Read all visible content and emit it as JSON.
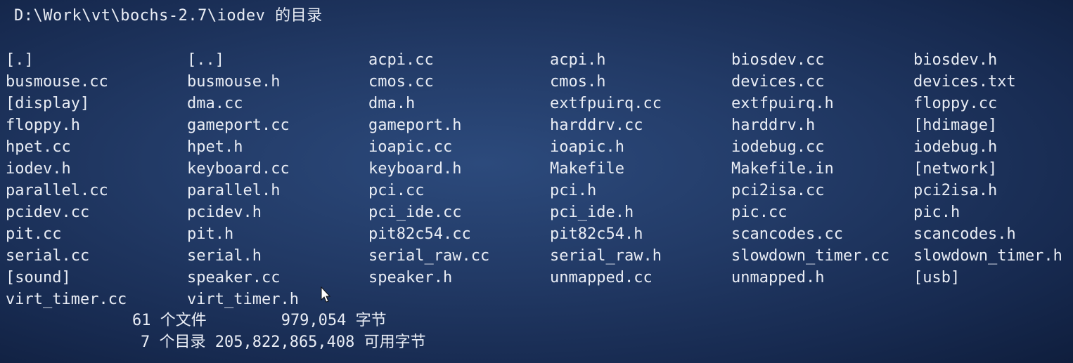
{
  "header": {
    "title": "D:\\Work\\vt\\bochs-2.7\\iodev 的目录"
  },
  "listing": [
    "[.]",
    "[..]",
    "acpi.cc",
    "acpi.h",
    "biosdev.cc",
    "biosdev.h",
    "busmouse.cc",
    "busmouse.h",
    "cmos.cc",
    "cmos.h",
    "devices.cc",
    "devices.txt",
    "[display]",
    "dma.cc",
    "dma.h",
    "extfpuirq.cc",
    "extfpuirq.h",
    "floppy.cc",
    "floppy.h",
    "gameport.cc",
    "gameport.h",
    "harddrv.cc",
    "harddrv.h",
    "[hdimage]",
    "hpet.cc",
    "hpet.h",
    "ioapic.cc",
    "ioapic.h",
    "iodebug.cc",
    "iodebug.h",
    "iodev.h",
    "keyboard.cc",
    "keyboard.h",
    "Makefile",
    "Makefile.in",
    "[network]",
    "parallel.cc",
    "parallel.h",
    "pci.cc",
    "pci.h",
    "pci2isa.cc",
    "pci2isa.h",
    "pcidev.cc",
    "pcidev.h",
    "pci_ide.cc",
    "pci_ide.h",
    "pic.cc",
    "pic.h",
    "pit.cc",
    "pit.h",
    "pit82c54.cc",
    "pit82c54.h",
    "scancodes.cc",
    "scancodes.h",
    "serial.cc",
    "serial.h",
    "serial_raw.cc",
    "serial_raw.h",
    "slowdown_timer.cc",
    "slowdown_timer.h",
    "[sound]",
    "speaker.cc",
    "speaker.h",
    "unmapped.cc",
    "unmapped.h",
    "[usb]",
    "virt_timer.cc",
    "virt_timer.h"
  ],
  "summary": {
    "files_line": "61 个文件        979,054 字节",
    "dirs_line": "7 个目录 205,822,865,408 可用字节"
  },
  "icons": {
    "cursor": "mouse-pointer-icon"
  },
  "colors": {
    "text": "#e9edf5",
    "background": "#223a66"
  }
}
